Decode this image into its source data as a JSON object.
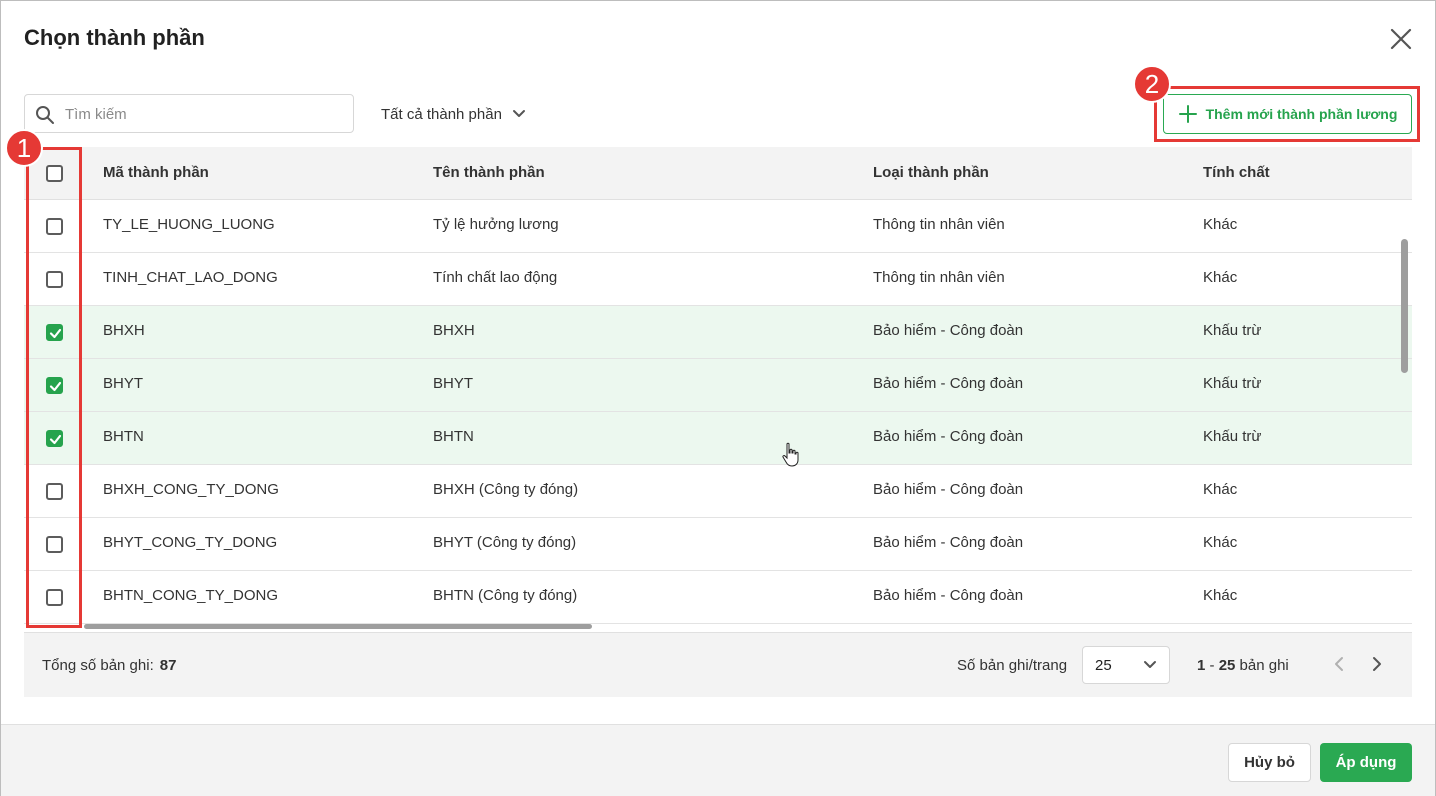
{
  "dialog": {
    "title": "Chọn thành phần"
  },
  "toolbar": {
    "search_placeholder": "Tìm kiếm",
    "filter_label": "Tất cả thành phần",
    "add_button_label": "Thêm mới thành phần lương"
  },
  "annotations": {
    "badge_1": "1",
    "badge_2": "2",
    "highlight_color": "#e53935"
  },
  "table": {
    "columns": [
      "Mã thành phần",
      "Tên thành phần",
      "Loại thành phần",
      "Tính chất"
    ],
    "rows": [
      {
        "code": "TY_LE_HUONG_LUONG",
        "name": "Tỷ lệ hưởng lương",
        "type": "Thông tin nhân viên",
        "nature": "Khác",
        "checked": false
      },
      {
        "code": "TINH_CHAT_LAO_DONG",
        "name": "Tính chất lao động",
        "type": "Thông tin nhân viên",
        "nature": "Khác",
        "checked": false
      },
      {
        "code": "BHXH",
        "name": "BHXH",
        "type": "Bảo hiểm - Công đoàn",
        "nature": "Khấu trừ",
        "checked": true
      },
      {
        "code": "BHYT",
        "name": "BHYT",
        "type": "Bảo hiểm - Công đoàn",
        "nature": "Khấu trừ",
        "checked": true
      },
      {
        "code": "BHTN",
        "name": "BHTN",
        "type": "Bảo hiểm - Công đoàn",
        "nature": "Khấu trừ",
        "checked": true
      },
      {
        "code": "BHXH_CONG_TY_DONG",
        "name": "BHXH (Công ty đóng)",
        "type": "Bảo hiểm - Công đoàn",
        "nature": "Khác",
        "checked": false
      },
      {
        "code": "BHYT_CONG_TY_DONG",
        "name": "BHYT (Công ty đóng)",
        "type": "Bảo hiểm - Công đoàn",
        "nature": "Khác",
        "checked": false
      },
      {
        "code": "BHTN_CONG_TY_DONG",
        "name": "BHTN (Công ty đóng)",
        "type": "Bảo hiểm - Công đoàn",
        "nature": "Khác",
        "checked": false
      }
    ]
  },
  "footer": {
    "total_label": "Tổng số bản ghi:",
    "total_value": "87",
    "per_page_label": "Số bản ghi/trang",
    "per_page_value": "25",
    "range_start": "1",
    "range_sep": " - ",
    "range_end": "25",
    "range_suffix": " bản ghi"
  },
  "actions": {
    "cancel_label": "Hủy bỏ",
    "apply_label": "Áp dụng"
  },
  "colors": {
    "accent": "#2aa952",
    "selected_row": "#ecf8ef"
  }
}
